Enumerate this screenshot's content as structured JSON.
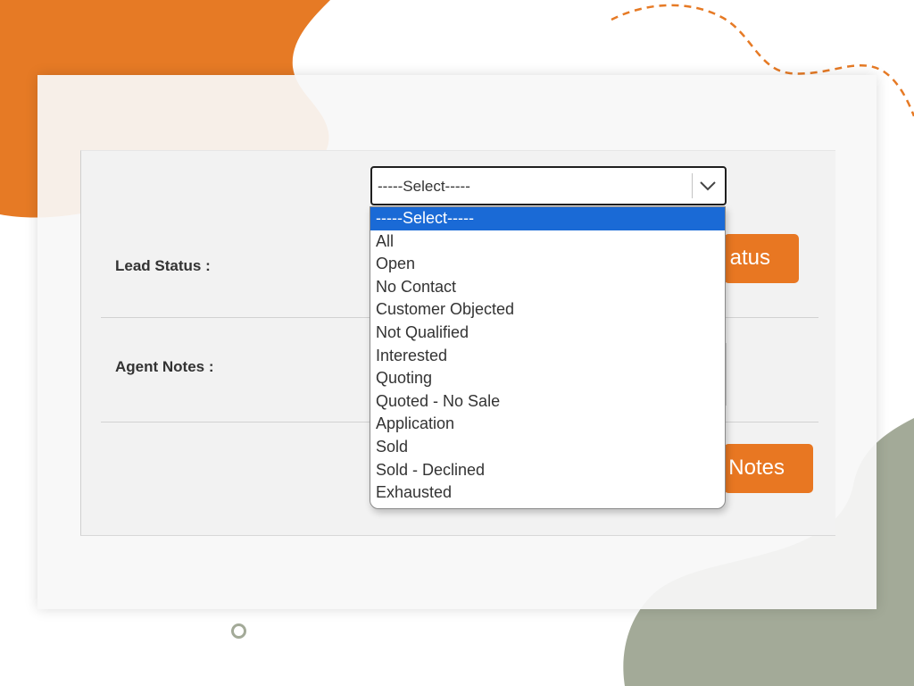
{
  "form": {
    "lead_status_label": "Lead Status :",
    "agent_notes_label": "Agent Notes :",
    "lead_status_select": {
      "selected": "-----Select-----",
      "options": [
        "-----Select-----",
        "All",
        "Open",
        "No Contact",
        "Customer Objected",
        "Not Qualified",
        "Interested",
        "Quoting",
        "Quoted - No Sale",
        "Application",
        "Sold",
        "Sold - Declined",
        "Exhausted"
      ]
    },
    "update_status_button_visible_text": "atus",
    "save_notes_button_visible_text": "Notes"
  },
  "icons": {
    "select_arrow": "chevron-down-icon"
  },
  "colors": {
    "accent_orange": "#e87722",
    "selected_option_blue": "#1a6ad6",
    "decor_green": "#a3aa98"
  }
}
